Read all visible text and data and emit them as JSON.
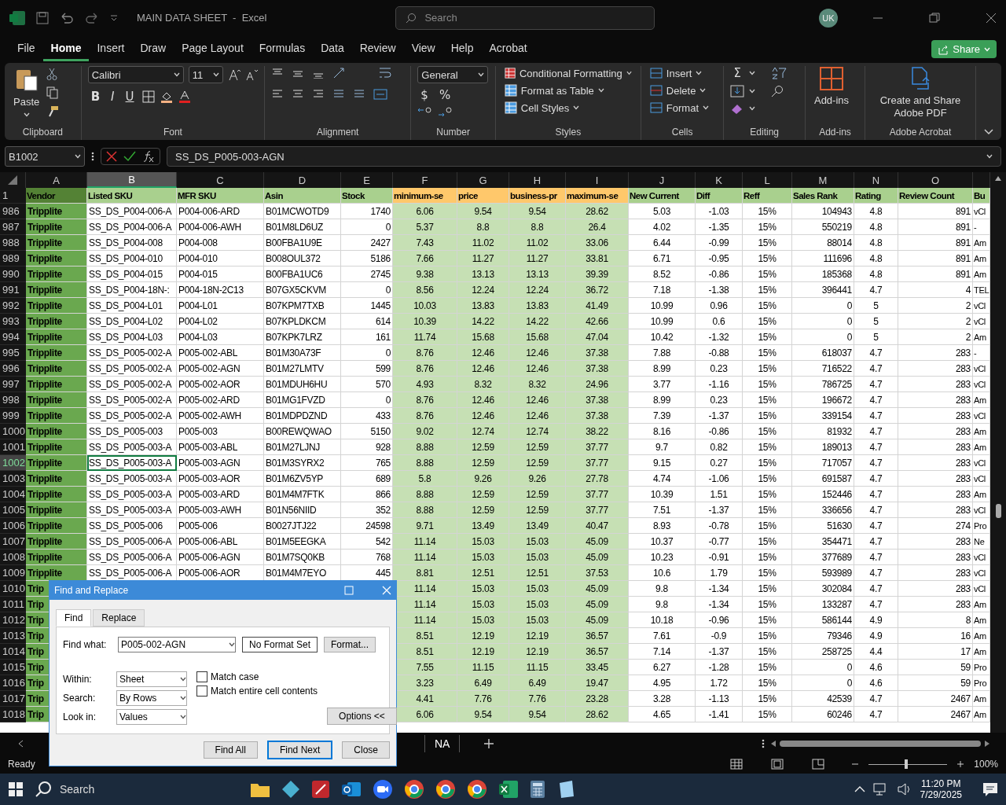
{
  "title_bar": {
    "title": "MAIN DATA SHEET  -  Excel",
    "search_placeholder": "Search",
    "avatar": "UK"
  },
  "menu_tabs": [
    {
      "label": "File",
      "selected": false
    },
    {
      "label": "Home",
      "selected": true
    },
    {
      "label": "Insert",
      "selected": false
    },
    {
      "label": "Draw",
      "selected": false
    },
    {
      "label": "Page Layout",
      "selected": false
    },
    {
      "label": "Formulas",
      "selected": false
    },
    {
      "label": "Data",
      "selected": false
    },
    {
      "label": "Review",
      "selected": false
    },
    {
      "label": "View",
      "selected": false
    },
    {
      "label": "Help",
      "selected": false
    },
    {
      "label": "Acrobat",
      "selected": false
    }
  ],
  "share_button": "Share",
  "ribbon": {
    "clipboard": {
      "paste": "Paste",
      "label": "Clipboard"
    },
    "font": {
      "family": "Calibri",
      "size": "11",
      "styles": [
        "B",
        "I",
        "U"
      ],
      "label": "Font"
    },
    "alignment": {
      "label": "Alignment"
    },
    "number": {
      "format": "General",
      "symbols": [
        "$",
        "%"
      ],
      "label": "Number"
    },
    "styles": {
      "items": [
        "Conditional Formatting",
        "Format as Table",
        "Cell Styles"
      ],
      "label": "Styles"
    },
    "cells": {
      "items": [
        "Insert",
        "Delete",
        "Format"
      ],
      "label": "Cells"
    },
    "editing": {
      "sum_symbol": "Σ",
      "label": "Editing"
    },
    "addins": {
      "button": "Add-ins",
      "label": "Add-ins"
    },
    "acrobat": {
      "button": "Create and Share Adobe PDF",
      "label": "Adobe Acrobat"
    }
  },
  "formula_bar": {
    "name_box": "B1002",
    "formula": "SS_DS_P005-003-AGN"
  },
  "columns": [
    {
      "letter": "A",
      "header": "Vendor",
      "color": "#548235",
      "selected": false
    },
    {
      "letter": "B",
      "header": "Listed SKU",
      "color": "#a9d08e",
      "selected": true
    },
    {
      "letter": "C",
      "header": "MFR SKU",
      "color": "#a9d08e",
      "selected": false
    },
    {
      "letter": "D",
      "header": "Asin",
      "color": "#a9d08e",
      "selected": false
    },
    {
      "letter": "E",
      "header": "Stock",
      "color": "#a9d08e",
      "selected": false
    },
    {
      "letter": "F",
      "header": "minimum-se",
      "color": "#ffc86b",
      "selected": false
    },
    {
      "letter": "G",
      "header": "price",
      "color": "#ffc86b",
      "selected": false
    },
    {
      "letter": "H",
      "header": "business-pr",
      "color": "#ffc86b",
      "selected": false
    },
    {
      "letter": "I",
      "header": "maximum-se",
      "color": "#ffc86b",
      "selected": false
    },
    {
      "letter": "J",
      "header": "New Current",
      "color": "#a9d08e",
      "selected": false
    },
    {
      "letter": "K",
      "header": "Diff",
      "color": "#a9d08e",
      "selected": false
    },
    {
      "letter": "L",
      "header": "Reff",
      "color": "#a9d08e",
      "selected": false
    },
    {
      "letter": "M",
      "header": "Sales Rank",
      "color": "#a9d08e",
      "selected": false
    },
    {
      "letter": "N",
      "header": "Rating",
      "color": "#a9d08e",
      "selected": false
    },
    {
      "letter": "O",
      "header": "Review Count",
      "color": "#a9d08e",
      "selected": false
    },
    {
      "header": "Bu",
      "color": "#a9d08e",
      "selected": false
    }
  ],
  "header_row_number": "1",
  "rows": [
    {
      "num": "986",
      "selected": false,
      "cells": [
        "Tripplite",
        "SS_DS_P004-006-A",
        "P004-006-ARD",
        "B01MCWOTD9",
        "1740",
        "6.06",
        "9.54",
        "9.54",
        "28.62",
        "5.03",
        "-1.03",
        "15%",
        "104943",
        "4.8",
        "891",
        "vCl"
      ]
    },
    {
      "num": "987",
      "selected": false,
      "cells": [
        "Tripplite",
        "SS_DS_P004-006-A",
        "P004-006-AWH",
        "B01M8LD6UZ",
        "0",
        "5.37",
        "8.8",
        "8.8",
        "26.4",
        "4.02",
        "-1.35",
        "15%",
        "550219",
        "4.8",
        "891",
        "-"
      ]
    },
    {
      "num": "988",
      "selected": false,
      "cells": [
        "Tripplite",
        "SS_DS_P004-008",
        "P004-008",
        "B00FBA1U9E",
        "2427",
        "7.43",
        "11.02",
        "11.02",
        "33.06",
        "6.44",
        "-0.99",
        "15%",
        "88014",
        "4.8",
        "891",
        "Am"
      ]
    },
    {
      "num": "989",
      "selected": false,
      "cells": [
        "Tripplite",
        "SS_DS_P004-010",
        "P004-010",
        "B008OUL372",
        "5186",
        "7.66",
        "11.27",
        "11.27",
        "33.81",
        "6.71",
        "-0.95",
        "15%",
        "111696",
        "4.8",
        "891",
        "Am"
      ]
    },
    {
      "num": "990",
      "selected": false,
      "cells": [
        "Tripplite",
        "SS_DS_P004-015",
        "P004-015",
        "B00FBA1UC6",
        "2745",
        "9.38",
        "13.13",
        "13.13",
        "39.39",
        "8.52",
        "-0.86",
        "15%",
        "185368",
        "4.8",
        "891",
        "Am"
      ]
    },
    {
      "num": "991",
      "selected": false,
      "cells": [
        "Tripplite",
        "SS_DS_P004-18N-:",
        "P004-18N-2C13",
        "B07GX5CKVM",
        "0",
        "8.56",
        "12.24",
        "12.24",
        "36.72",
        "7.18",
        "-1.38",
        "15%",
        "396441",
        "4.7",
        "4",
        "TEL"
      ]
    },
    {
      "num": "992",
      "selected": false,
      "cells": [
        "Tripplite",
        "SS_DS_P004-L01",
        "P004-L01",
        "B07KPM7TXB",
        "1445",
        "10.03",
        "13.83",
        "13.83",
        "41.49",
        "10.99",
        "0.96",
        "15%",
        "0",
        "5",
        "2",
        "vCl"
      ]
    },
    {
      "num": "993",
      "selected": false,
      "cells": [
        "Tripplite",
        "SS_DS_P004-L02",
        "P004-L02",
        "B07KPLDKCM",
        "614",
        "10.39",
        "14.22",
        "14.22",
        "42.66",
        "10.99",
        "0.6",
        "15%",
        "0",
        "5",
        "2",
        "vCl"
      ]
    },
    {
      "num": "994",
      "selected": false,
      "cells": [
        "Tripplite",
        "SS_DS_P004-L03",
        "P004-L03",
        "B07KPK7LRZ",
        "161",
        "11.74",
        "15.68",
        "15.68",
        "47.04",
        "10.42",
        "-1.32",
        "15%",
        "0",
        "5",
        "2",
        "Am"
      ]
    },
    {
      "num": "995",
      "selected": false,
      "cells": [
        "Tripplite",
        "SS_DS_P005-002-A",
        "P005-002-ABL",
        "B01M30A73F",
        "0",
        "8.76",
        "12.46",
        "12.46",
        "37.38",
        "7.88",
        "-0.88",
        "15%",
        "618037",
        "4.7",
        "283",
        "-"
      ]
    },
    {
      "num": "996",
      "selected": false,
      "cells": [
        "Tripplite",
        "SS_DS_P005-002-A",
        "P005-002-AGN",
        "B01M27LMTV",
        "599",
        "8.76",
        "12.46",
        "12.46",
        "37.38",
        "8.99",
        "0.23",
        "15%",
        "716522",
        "4.7",
        "283",
        "vCl"
      ]
    },
    {
      "num": "997",
      "selected": false,
      "cells": [
        "Tripplite",
        "SS_DS_P005-002-A",
        "P005-002-AOR",
        "B01MDUH6HU",
        "570",
        "4.93",
        "8.32",
        "8.32",
        "24.96",
        "3.77",
        "-1.16",
        "15%",
        "786725",
        "4.7",
        "283",
        "vCl"
      ]
    },
    {
      "num": "998",
      "selected": false,
      "cells": [
        "Tripplite",
        "SS_DS_P005-002-A",
        "P005-002-ARD",
        "B01MG1FVZD",
        "0",
        "8.76",
        "12.46",
        "12.46",
        "37.38",
        "8.99",
        "0.23",
        "15%",
        "196672",
        "4.7",
        "283",
        "Am"
      ]
    },
    {
      "num": "999",
      "selected": false,
      "cells": [
        "Tripplite",
        "SS_DS_P005-002-A",
        "P005-002-AWH",
        "B01MDPDZND",
        "433",
        "8.76",
        "12.46",
        "12.46",
        "37.38",
        "7.39",
        "-1.37",
        "15%",
        "339154",
        "4.7",
        "283",
        "vCl"
      ]
    },
    {
      "num": "1000",
      "selected": false,
      "cells": [
        "Tripplite",
        "SS_DS_P005-003",
        "P005-003",
        "B00REWQWAO",
        "5150",
        "9.02",
        "12.74",
        "12.74",
        "38.22",
        "8.16",
        "-0.86",
        "15%",
        "81932",
        "4.7",
        "283",
        "Am"
      ]
    },
    {
      "num": "1001",
      "selected": false,
      "cells": [
        "Tripplite",
        "SS_DS_P005-003-A",
        "P005-003-ABL",
        "B01M27LJNJ",
        "928",
        "8.88",
        "12.59",
        "12.59",
        "37.77",
        "9.7",
        "0.82",
        "15%",
        "189013",
        "4.7",
        "283",
        "Am"
      ]
    },
    {
      "num": "1002",
      "selected": true,
      "cells": [
        "Tripplite",
        "SS_DS_P005-003-A",
        "P005-003-AGN",
        "B01M3SYRX2",
        "765",
        "8.88",
        "12.59",
        "12.59",
        "37.77",
        "9.15",
        "0.27",
        "15%",
        "717057",
        "4.7",
        "283",
        "vCl"
      ]
    },
    {
      "num": "1003",
      "selected": false,
      "cells": [
        "Tripplite",
        "SS_DS_P005-003-A",
        "P005-003-AOR",
        "B01M6ZV5YP",
        "689",
        "5.8",
        "9.26",
        "9.26",
        "27.78",
        "4.74",
        "-1.06",
        "15%",
        "691587",
        "4.7",
        "283",
        "vCl"
      ]
    },
    {
      "num": "1004",
      "selected": false,
      "cells": [
        "Tripplite",
        "SS_DS_P005-003-A",
        "P005-003-ARD",
        "B01M4M7FTK",
        "866",
        "8.88",
        "12.59",
        "12.59",
        "37.77",
        "10.39",
        "1.51",
        "15%",
        "152446",
        "4.7",
        "283",
        "Am"
      ]
    },
    {
      "num": "1005",
      "selected": false,
      "cells": [
        "Tripplite",
        "SS_DS_P005-003-A",
        "P005-003-AWH",
        "B01N56NIID",
        "352",
        "8.88",
        "12.59",
        "12.59",
        "37.77",
        "7.51",
        "-1.37",
        "15%",
        "336656",
        "4.7",
        "283",
        "vCl"
      ]
    },
    {
      "num": "1006",
      "selected": false,
      "cells": [
        "Tripplite",
        "SS_DS_P005-006",
        "P005-006",
        "B0027JTJ22",
        "24598",
        "9.71",
        "13.49",
        "13.49",
        "40.47",
        "8.93",
        "-0.78",
        "15%",
        "51630",
        "4.7",
        "274",
        "Pro"
      ]
    },
    {
      "num": "1007",
      "selected": false,
      "cells": [
        "Tripplite",
        "SS_DS_P005-006-A",
        "P005-006-ABL",
        "B01M5EEGKA",
        "542",
        "11.14",
        "15.03",
        "15.03",
        "45.09",
        "10.37",
        "-0.77",
        "15%",
        "354471",
        "4.7",
        "283",
        "Ne"
      ]
    },
    {
      "num": "1008",
      "selected": false,
      "cells": [
        "Tripplite",
        "SS_DS_P005-006-A",
        "P005-006-AGN",
        "B01M7SQ0KB",
        "768",
        "11.14",
        "15.03",
        "15.03",
        "45.09",
        "10.23",
        "-0.91",
        "15%",
        "377689",
        "4.7",
        "283",
        "vCl"
      ]
    },
    {
      "num": "1009",
      "selected": false,
      "cells": [
        "Tripplite",
        "SS_DS_P005-006-A",
        "P005-006-AOR",
        "B01M4M7EYO",
        "445",
        "8.81",
        "12.51",
        "12.51",
        "37.53",
        "10.6",
        "1.79",
        "15%",
        "593989",
        "4.7",
        "283",
        "vCl"
      ]
    },
    {
      "num": "1010",
      "selected": false,
      "cells": [
        "Trip",
        null,
        null,
        null,
        null,
        "11.14",
        "15.03",
        "15.03",
        "45.09",
        "9.8",
        "-1.34",
        "15%",
        "302084",
        "4.7",
        "283",
        "vCl"
      ]
    },
    {
      "num": "1011",
      "selected": false,
      "cells": [
        "Trip",
        null,
        null,
        null,
        null,
        "11.14",
        "15.03",
        "15.03",
        "45.09",
        "9.8",
        "-1.34",
        "15%",
        "133287",
        "4.7",
        "283",
        "Am"
      ]
    },
    {
      "num": "1012",
      "selected": false,
      "cells": [
        "Trip",
        null,
        null,
        null,
        null,
        "11.14",
        "15.03",
        "15.03",
        "45.09",
        "10.18",
        "-0.96",
        "15%",
        "586144",
        "4.9",
        "8",
        "Am"
      ]
    },
    {
      "num": "1013",
      "selected": false,
      "cells": [
        "Trip",
        null,
        null,
        null,
        null,
        "8.51",
        "12.19",
        "12.19",
        "36.57",
        "7.61",
        "-0.9",
        "15%",
        "79346",
        "4.9",
        "16",
        "Am"
      ]
    },
    {
      "num": "1014",
      "selected": false,
      "cells": [
        "Trip",
        null,
        null,
        null,
        null,
        "8.51",
        "12.19",
        "12.19",
        "36.57",
        "7.14",
        "-1.37",
        "15%",
        "258725",
        "4.4",
        "17",
        "Am"
      ]
    },
    {
      "num": "1015",
      "selected": false,
      "cells": [
        "Trip",
        null,
        null,
        null,
        null,
        "7.55",
        "11.15",
        "11.15",
        "33.45",
        "6.27",
        "-1.28",
        "15%",
        "0",
        "4.6",
        "59",
        "Pro"
      ]
    },
    {
      "num": "1016",
      "selected": false,
      "cells": [
        "Trip",
        null,
        null,
        null,
        null,
        "3.23",
        "6.49",
        "6.49",
        "19.47",
        "4.95",
        "1.72",
        "15%",
        "0",
        "4.6",
        "59",
        "Pro"
      ]
    },
    {
      "num": "1017",
      "selected": false,
      "cells": [
        "Trip",
        null,
        null,
        null,
        null,
        "4.41",
        "7.76",
        "7.76",
        "23.28",
        "3.28",
        "-1.13",
        "15%",
        "42539",
        "4.7",
        "2467",
        "Am"
      ]
    },
    {
      "num": "1018",
      "selected": false,
      "cells": [
        "Trip",
        null,
        null,
        null,
        null,
        "6.06",
        "9.54",
        "9.54",
        "28.62",
        "4.65",
        "-1.41",
        "15%",
        "60246",
        "4.7",
        "2467",
        "Am"
      ]
    }
  ],
  "sheet_tabs": [
    {
      "label": "NA",
      "selected": true
    }
  ],
  "status_bar": {
    "state": "Ready",
    "zoom": {
      "level": 0.48
    },
    "zoom_label": "100%"
  },
  "dialog": {
    "title": "Find and Replace",
    "tabs": [
      {
        "label": "Find",
        "selected": true
      },
      {
        "label": "Replace",
        "selected": false
      }
    ],
    "find_what": {
      "label": "Find what:",
      "value": "P005-002-AGN"
    },
    "format_status": "No Format Set",
    "format_button": "Format...",
    "dropdowns": [
      {
        "label": "Within:",
        "value": "Sheet"
      },
      {
        "label": "Search:",
        "value": "By Rows"
      },
      {
        "label": "Look in:",
        "value": "Values"
      }
    ],
    "checkboxes": [
      {
        "label": "Match case",
        "checked": false
      },
      {
        "label": "Match entire cell contents",
        "checked": false
      }
    ],
    "options_button": "Options <<",
    "buttons": [
      {
        "label": "Find All",
        "selected": false
      },
      {
        "label": "Find Next",
        "selected": true
      },
      {
        "label": "Close",
        "selected": false
      }
    ]
  },
  "taskbar": {
    "search": "Search",
    "time": "11:20 PM",
    "date": "7/29/2025"
  }
}
